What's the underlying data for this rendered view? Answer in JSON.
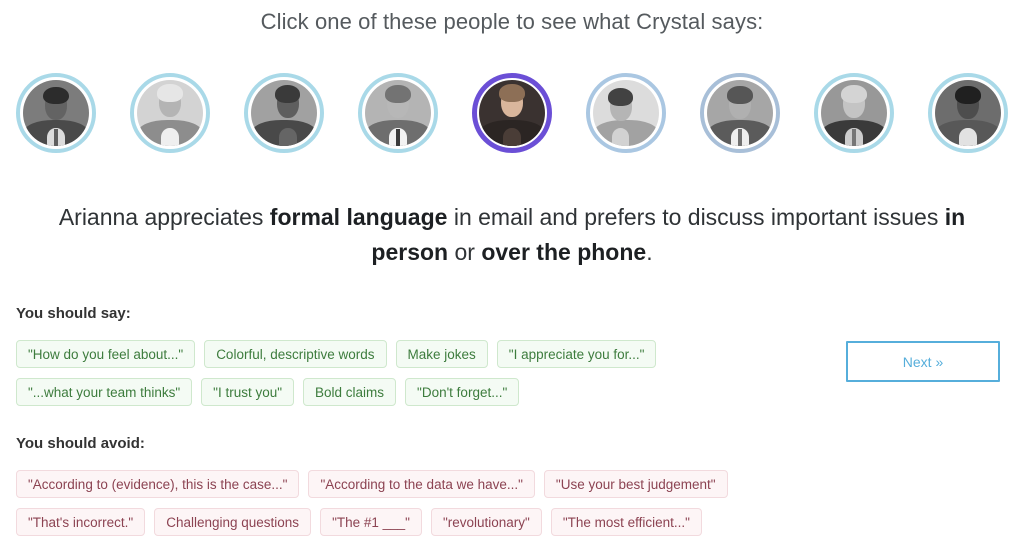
{
  "header": {
    "title": "Click one of these people to see what Crystal says:"
  },
  "colors": {
    "ring_default": "#a9d9e8",
    "ring_selected": "#6b4fd6",
    "good_text": "#3d7c3d",
    "good_bg": "#f4fbf4",
    "good_border": "#cfe8cd",
    "bad_text": "#8c4352",
    "bad_bg": "#fdf5f6",
    "bad_border": "#f2dade",
    "button_blue": "#56aedb"
  },
  "people": [
    {
      "name": "barack-obama",
      "selected": false,
      "ring": "#a9d9e8"
    },
    {
      "name": "richard-branson",
      "selected": false,
      "ring": "#a9d9e8"
    },
    {
      "name": "speaker-on-stage",
      "selected": false,
      "ring": "#a9d9e8"
    },
    {
      "name": "peyton-manning",
      "selected": false,
      "ring": "#a9d9e8"
    },
    {
      "name": "arianna-huffington",
      "selected": true,
      "ring": "#6b4fd6"
    },
    {
      "name": "trophy-holder",
      "selected": false,
      "ring": "#aac7e2"
    },
    {
      "name": "sean-parker",
      "selected": false,
      "ring": "#a8bfd8"
    },
    {
      "name": "jack-welch",
      "selected": false,
      "ring": "#a9d9e8"
    },
    {
      "name": "tiki-barber",
      "selected": false,
      "ring": "#a9d9e8"
    }
  ],
  "description": {
    "part1": "Arianna appreciates ",
    "bold1": "formal language",
    "part2": " in email and prefers to discuss important issues ",
    "bold2": "in person",
    "part3": " or ",
    "bold3": "over the phone",
    "part4": "."
  },
  "say": {
    "label": "You should say:",
    "rows": [
      [
        "\"How do you feel about...\"",
        "Colorful, descriptive words",
        "Make jokes",
        "\"I appreciate you for...\""
      ],
      [
        "\"...what your team thinks\"",
        "\"I trust you\"",
        "Bold claims",
        "\"Don't forget...\""
      ]
    ]
  },
  "avoid": {
    "label": "You should avoid:",
    "rows": [
      [
        "\"According to (evidence), this is the case...\"",
        "\"According to the data we have...\"",
        "\"Use your best judgement\""
      ],
      [
        "\"That's incorrect.\"",
        "Challenging questions",
        "\"The #1 ___\"",
        "\"revolutionary\"",
        "\"The most efficient...\""
      ]
    ]
  },
  "next_button": {
    "label": "Next »"
  }
}
